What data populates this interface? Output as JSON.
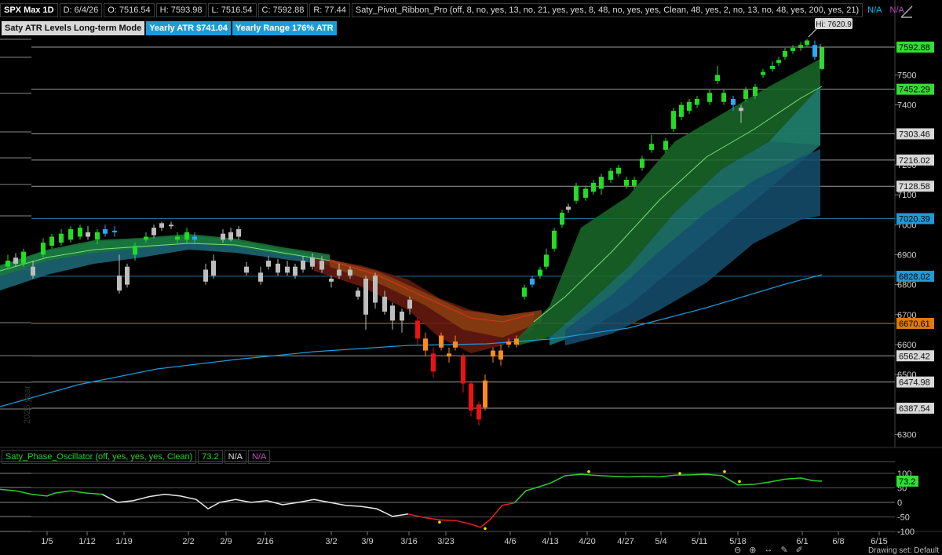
{
  "header": {
    "symbol": "SPX Max 1D",
    "date": "D: 6/4/26",
    "open": "O: 7516.54",
    "high": "H: 7593.98",
    "low": "L: 7516.54",
    "close": "C: 7592.88",
    "range": "R: 77.44",
    "study": "Saty_Pivot_Ribbon_Pro (off, 8, no, yes, 13, no, 21, yes, yes, 8, 48, no, yes, yes, Clean, 48, yes, 2, no, 13, no, 48, yes, 200, yes, 21)",
    "na1": "N/A",
    "na2": "N/A"
  },
  "badges": {
    "mode": "Saty ATR Levels Long-term Mode",
    "atr": "Yearly ATR $741.04",
    "range": "Yearly Range 176% ATR"
  },
  "hi_label": "Hi: 7620.9",
  "year_watermark": "2025 year",
  "price_axis": {
    "ticks": [
      "7500",
      "7400",
      "7200",
      "7100",
      "7000",
      "6900",
      "6800",
      "6700",
      "6600",
      "6500",
      "6300"
    ],
    "levels": [
      {
        "value": "7592.88",
        "kind": "green"
      },
      {
        "value": "7452.29",
        "kind": "green"
      },
      {
        "value": "7303.46",
        "kind": "gray"
      },
      {
        "value": "7216.02",
        "kind": "gray"
      },
      {
        "value": "7128.58",
        "kind": "gray"
      },
      {
        "value": "7020.39",
        "kind": "blue"
      },
      {
        "value": "6828.02",
        "kind": "blue"
      },
      {
        "value": "6670.61",
        "kind": "orange"
      },
      {
        "value": "6562.42",
        "kind": "gray"
      },
      {
        "value": "6474.98",
        "kind": "gray"
      },
      {
        "value": "6387.54",
        "kind": "gray"
      }
    ]
  },
  "oscillator": {
    "label": "Saty_Phase_Oscillator (off, yes, yes, yes, Clean)",
    "value": "73.2",
    "na1": "N/A",
    "na2": "N/A",
    "ticks": [
      "100",
      "50",
      "0",
      "-50",
      "-100"
    ],
    "current": "73.2"
  },
  "x_axis": {
    "labels": [
      "1/5",
      "1/12",
      "1/19",
      "2/2",
      "2/9",
      "2/16",
      "3/2",
      "3/9",
      "3/16",
      "3/23",
      "4/6",
      "4/13",
      "4/20",
      "4/27",
      "5/4",
      "5/11",
      "5/18",
      "6/1",
      "6/8",
      "6/15"
    ]
  },
  "footer": {
    "drawing_set": "Drawing set: Default"
  },
  "colors": {
    "up_green": "#22dd22",
    "down_red": "#ee1111",
    "neutral": "#bdbdbd",
    "blue_candle": "#2aa8ff",
    "orange": "#ff8c1a",
    "level_green": "#33dd33",
    "level_blue": "#1e9bd7",
    "level_orange": "#e07a10"
  }
}
